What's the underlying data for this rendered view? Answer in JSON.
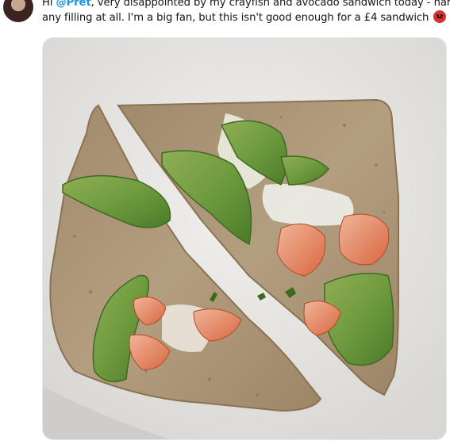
{
  "tweet": {
    "line1_prefix": "Hi ",
    "mention": "@Pret",
    "line1_suffix": ", very disappointed by my crayfish and avocado sandwich today - hardly",
    "line2": "any filling at all. I'm a big fan, but this isn't good enough for a £4 sandwich"
  },
  "emoji_icon": "angry-face-icon",
  "colors": {
    "mention": "#1b95e0",
    "text": "#14171a"
  }
}
